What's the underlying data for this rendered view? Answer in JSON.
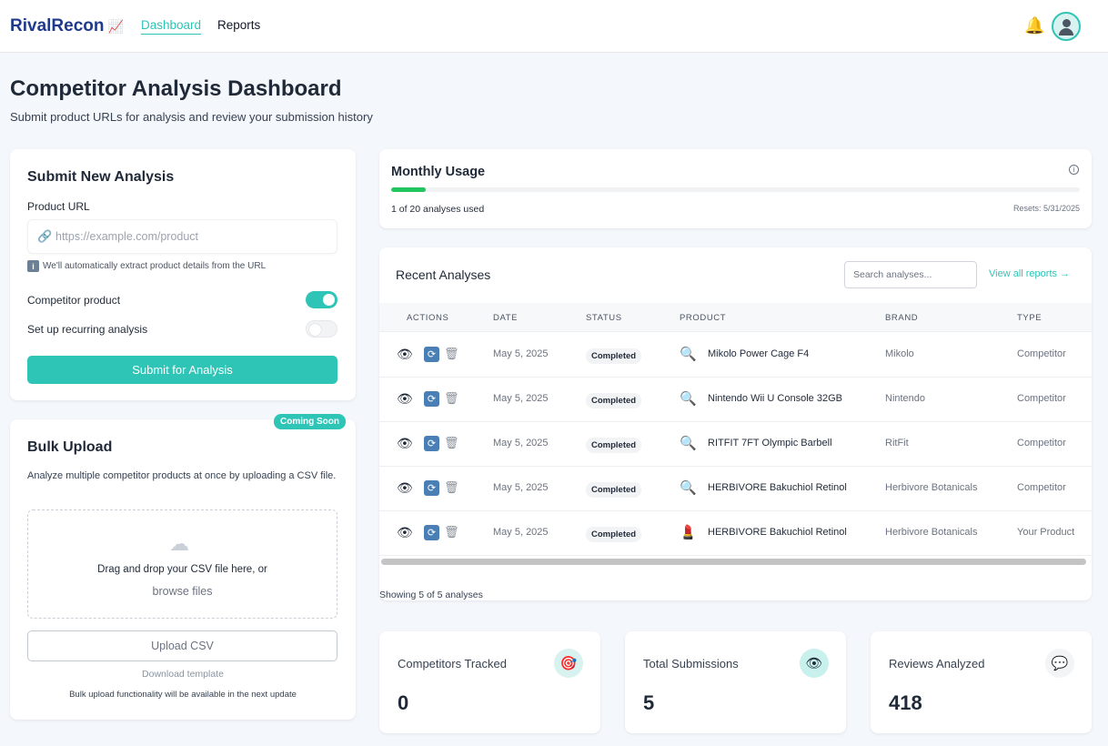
{
  "header": {
    "brand": "RivalRecon",
    "brand_icon": "chart-increasing-icon",
    "nav": [
      "Dashboard",
      "Reports"
    ],
    "active_nav": "Dashboard",
    "accent_color": "#2ec4b6"
  },
  "page": {
    "title": "Competitor Analysis Dashboard",
    "subtitle": "Submit product URLs for analysis and review your submission history"
  },
  "submit": {
    "title": "Submit New Analysis",
    "url_label": "Product URL",
    "url_placeholder": "https://example.com/product",
    "url_value": "",
    "hint": "We'll automatically extract product details from the URL",
    "competitor_label": "Competitor product",
    "competitor_on": true,
    "recurring_label": "Set up recurring analysis",
    "recurring_on": false,
    "submit_label": "Submit for Analysis"
  },
  "bulk": {
    "title": "Bulk Upload",
    "badge": "Coming Soon",
    "description": "Analyze multiple competitor products at once by uploading a CSV file.",
    "drop_text": "Drag and drop your CSV file here, or",
    "browse": "browse files",
    "upload_label": "Upload CSV",
    "download_template": "Download template",
    "note": "Bulk upload functionality will be available in the next update"
  },
  "usage": {
    "title": "Monthly Usage",
    "used": 1,
    "limit": 20,
    "text": "1 of 20 analyses used",
    "reset": "Resets: 5/31/2025",
    "fill_color": "#22c55e"
  },
  "recent": {
    "title": "Recent Analyses",
    "search_placeholder": "Search analyses...",
    "view_all": "View all reports →",
    "columns": [
      "ACTIONS",
      "DATE",
      "STATUS",
      "PRODUCT",
      "BRAND",
      "TYPE"
    ],
    "rows": [
      {
        "date": "May 5, 2025",
        "status": "Completed",
        "product": "Mikolo Power Cage F4",
        "brand": "Mikolo",
        "type": "Competitor",
        "icon": "magnifier-icon"
      },
      {
        "date": "May 5, 2025",
        "status": "Completed",
        "product": "Nintendo Wii U Console 32GB",
        "brand": "Nintendo",
        "type": "Competitor",
        "icon": "magnifier-icon"
      },
      {
        "date": "May 5, 2025",
        "status": "Completed",
        "product": "RITFIT 7FT Olympic Barbell",
        "brand": "RitFit",
        "type": "Competitor",
        "icon": "magnifier-icon"
      },
      {
        "date": "May 5, 2025",
        "status": "Completed",
        "product": "HERBIVORE Bakuchiol Retinol",
        "brand": "Herbivore Botanicals",
        "type": "Competitor",
        "icon": "magnifier-icon"
      },
      {
        "date": "May 5, 2025",
        "status": "Completed",
        "product": "HERBIVORE Bakuchiol Retinol",
        "brand": "Herbivore Botanicals",
        "type": "Your Product",
        "icon": "lipstick-icon"
      }
    ],
    "showing": "Showing 5 of 5 analyses"
  },
  "stats": [
    {
      "label": "Competitors Tracked",
      "value": "0",
      "icon": "target-icon",
      "icon_bg": "#d7f2ef"
    },
    {
      "label": "Total Submissions",
      "value": "5",
      "icon": "eye-icon",
      "icon_bg": "#c8f0ec"
    },
    {
      "label": "Reviews Analyzed",
      "value": "418",
      "icon": "speech-bubble-icon",
      "icon_bg": "#f3f4f6"
    }
  ]
}
